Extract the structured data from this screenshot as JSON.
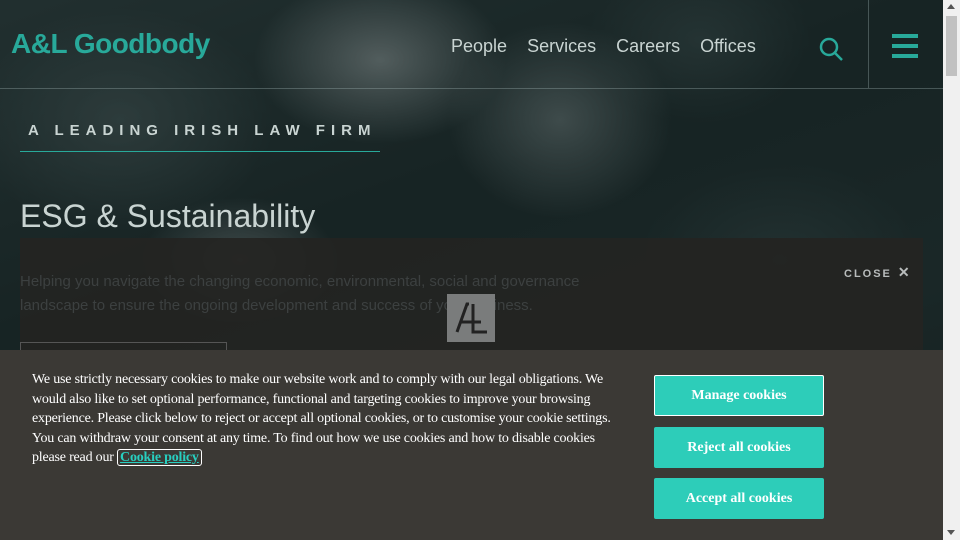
{
  "header": {
    "logo": "A&L Goodbody",
    "nav": [
      "People",
      "Services",
      "Careers",
      "Offices"
    ]
  },
  "hero": {
    "tagline": "A LEADING IRISH LAW FIRM",
    "title": "ESG & Sustainability",
    "intro": "Helping you navigate the changing economic, environmental, social and governance landscape to ensure the ongoing development and success of your business."
  },
  "modal": {
    "close_label": "CLOSE",
    "close_glyph": "✕"
  },
  "cookie": {
    "text": "We use strictly necessary cookies to make our website work and to comply with our legal obligations. We would also like to set optional performance, functional and targeting cookies to improve your browsing experience. Please click below to reject or accept all optional cookies, or to customise your cookie settings. You can withdraw your consent at any time. To find out how we use cookies and how to disable cookies please read our Cookie policy.",
    "link": "Cookie policy",
    "manage": "Manage cookies",
    "reject": "Reject all cookies",
    "accept": "Accept all cookies"
  },
  "colors": {
    "accent": "#28a99a",
    "button": "#2dcdb9",
    "banner": "#3b3935"
  },
  "icons": {
    "search": "search-icon",
    "menu": "hamburger-menu-icon",
    "loader": "al-logo-icon"
  }
}
